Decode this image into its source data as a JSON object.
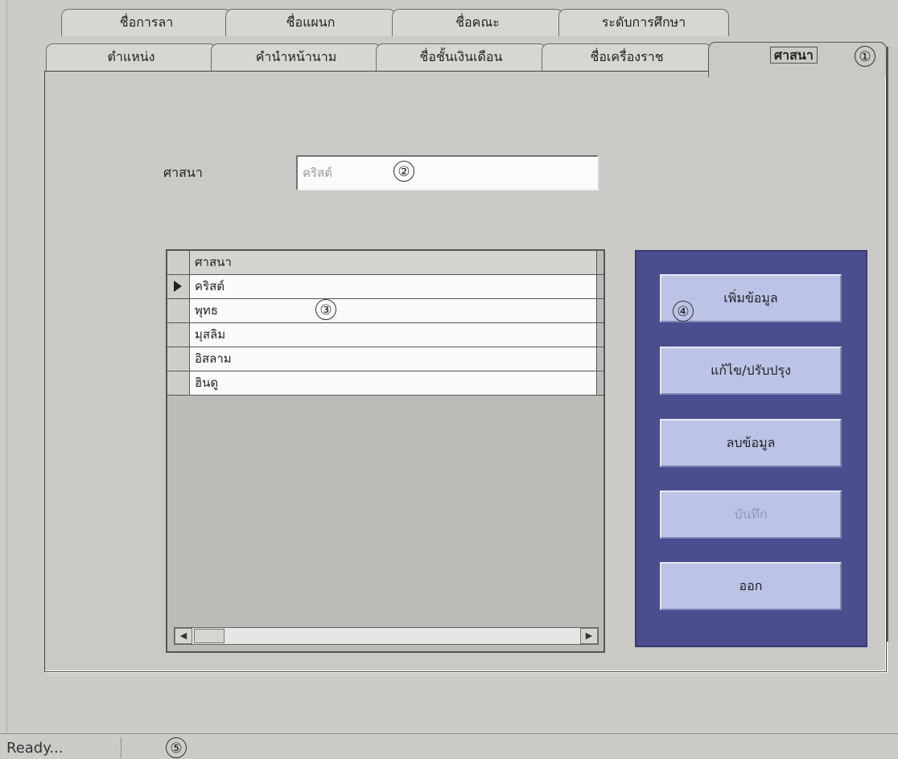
{
  "tabs_row1": [
    {
      "label": "ชื่อการลา"
    },
    {
      "label": "ชื่อแผนก"
    },
    {
      "label": "ชื่อคณะ"
    },
    {
      "label": "ระดับการศึกษา"
    }
  ],
  "tabs_row2": [
    {
      "label": "ตำแหน่ง"
    },
    {
      "label": "คำนำหน้านาม"
    },
    {
      "label": "ชื่อชั้นเงินเดือน"
    },
    {
      "label": "ชื่อเครื่องราช"
    }
  ],
  "active_tab": {
    "label": "ศาสนา"
  },
  "form": {
    "religion_label": "ศาสนา",
    "religion_value": "คริสต์"
  },
  "grid": {
    "header": "ศาสนา",
    "rows": [
      "คริสต์",
      "พุทธ",
      "มุสลิม",
      "อิสลาม",
      "ฮินดู"
    ],
    "selected_index": 0
  },
  "actions": {
    "add": "เพิ่มข้อมูล",
    "edit": "แก้ไข/ปรับปรุง",
    "delete": "ลบข้อมูล",
    "save": "บันทึก",
    "exit": "ออก"
  },
  "callouts": [
    "①",
    "②",
    "③",
    "④",
    "⑤"
  ],
  "status": {
    "text": "Ready..."
  },
  "colors": {
    "background": "#cdcbc8",
    "button_panel": "#4b4d8f",
    "button": "#bcc3e6"
  }
}
